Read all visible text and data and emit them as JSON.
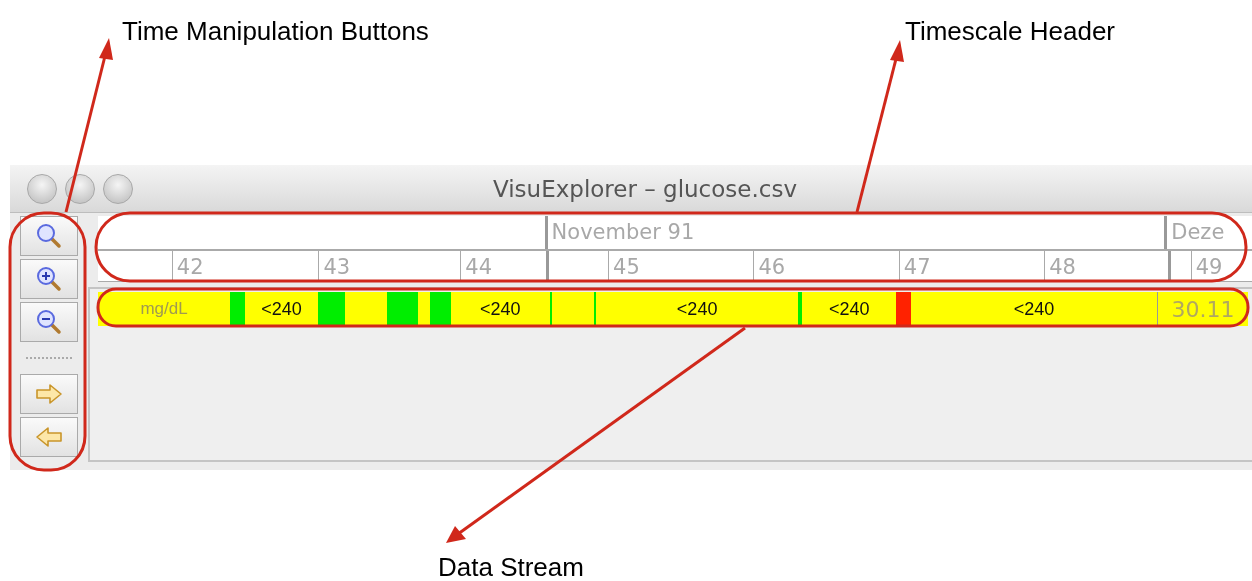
{
  "annotations": [
    {
      "label": "Time Manipulation Buttons"
    },
    {
      "label": "Timescale Header"
    },
    {
      "label": "Data Stream"
    }
  ],
  "window": {
    "title": "VisuExplorer – glucose.csv"
  },
  "toolbar": {
    "buttons": [
      {
        "kind": "zoom"
      },
      {
        "kind": "zoom-in"
      },
      {
        "kind": "zoom-out"
      },
      {
        "kind": "separator"
      },
      {
        "kind": "forward"
      },
      {
        "kind": "back"
      }
    ]
  },
  "header": {
    "months": [
      {
        "label": "November 91"
      },
      {
        "label": "Deze"
      }
    ],
    "weeks": [
      {
        "label": "42"
      },
      {
        "label": "43"
      },
      {
        "label": "44"
      },
      {
        "label": "45"
      },
      {
        "label": "46"
      },
      {
        "label": "47"
      },
      {
        "label": "48"
      },
      {
        "label": "49"
      }
    ]
  },
  "stream": {
    "unit": "mg/dL",
    "end_label": "30.11",
    "segments": [
      {
        "color": "#00ee00"
      },
      {
        "color": "#ffff00",
        "label": "<240"
      },
      {
        "color": "#00ee00"
      },
      {
        "color": "#ffff00"
      },
      {
        "color": "#00ee00"
      },
      {
        "color": "#ffff00"
      },
      {
        "color": "#00ee00"
      },
      {
        "color": "#ffff00",
        "label": "<240"
      },
      {
        "color": "#00ee00"
      },
      {
        "color": "#ffff00"
      },
      {
        "color": "#00ee00"
      },
      {
        "color": "#ffff00",
        "label": "<240"
      },
      {
        "color": "#00ee00"
      },
      {
        "color": "#ffff00",
        "label": "<240"
      },
      {
        "color": "#ff2200"
      },
      {
        "color": "#ffff00",
        "label": "<240"
      }
    ]
  }
}
